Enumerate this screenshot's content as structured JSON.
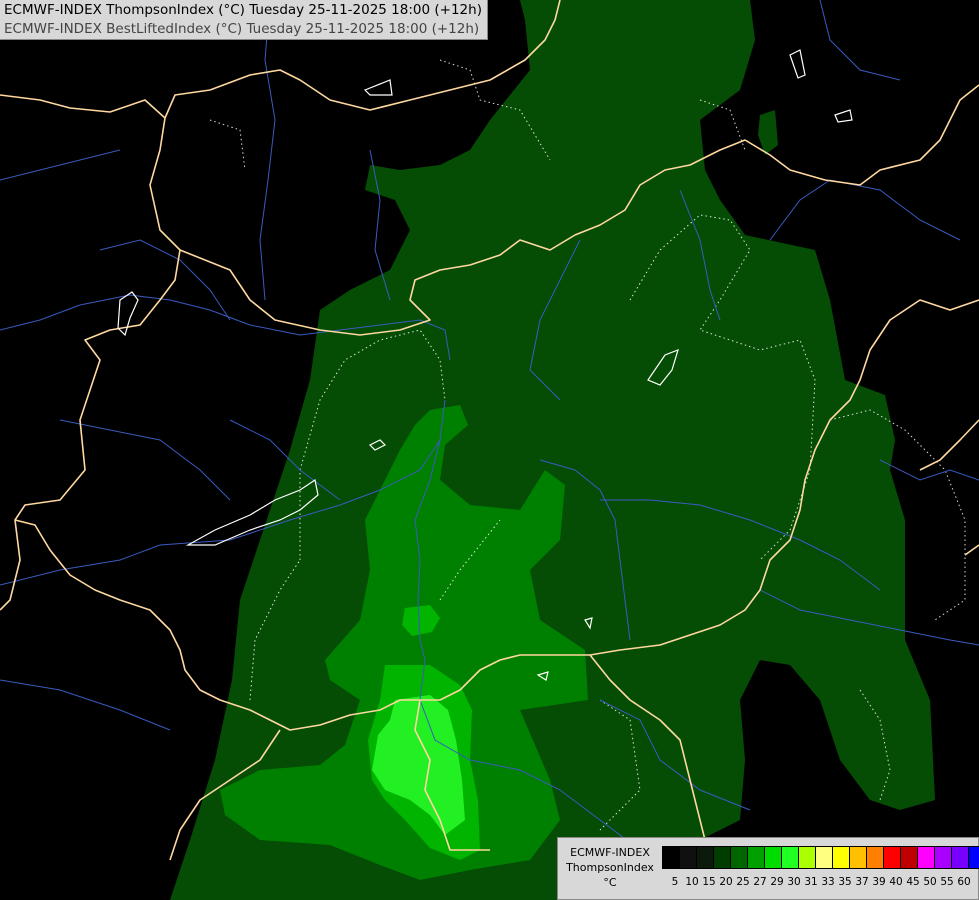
{
  "titles": {
    "line1": "ECMWF-INDEX ThompsonIndex (°C) Tuesday 25-11-2025 18:00 (+12h)",
    "line2": "ECMWF-INDEX BestLiftedIndex (°C) Tuesday 25-11-2025 18:00 (+12h)"
  },
  "legend": {
    "line1": "ECMWF-INDEX",
    "line2": "ThompsonIndex",
    "unit": "°C",
    "ticks": [
      "5",
      "10",
      "15",
      "20",
      "25",
      "27",
      "29",
      "30",
      "31",
      "33",
      "35",
      "37",
      "39",
      "40",
      "45",
      "50",
      "55",
      "60"
    ],
    "colors": [
      "#000000",
      "#101010",
      "#0c1a0c",
      "#003d00",
      "#006600",
      "#00a000",
      "#00dc00",
      "#22ff22",
      "#aaff00",
      "#ffff80",
      "#ffff00",
      "#ffc000",
      "#ff7f00",
      "#ff0000",
      "#c00000",
      "#ff00ff",
      "#aa00ff",
      "#7700ff",
      "#0000ff"
    ]
  },
  "map_colors": {
    "background": "#000000",
    "ti_20_25": "#054d05",
    "ti_25_27": "#008000",
    "ti_27_29": "#00b400",
    "ti_29_30": "#00e800",
    "ti_30_31": "#33ff33",
    "borders": "#ffd8a0",
    "rivers": "#3a5bbf",
    "lakes": "#ffffff",
    "lifted_index_contours": "#ffffff"
  }
}
